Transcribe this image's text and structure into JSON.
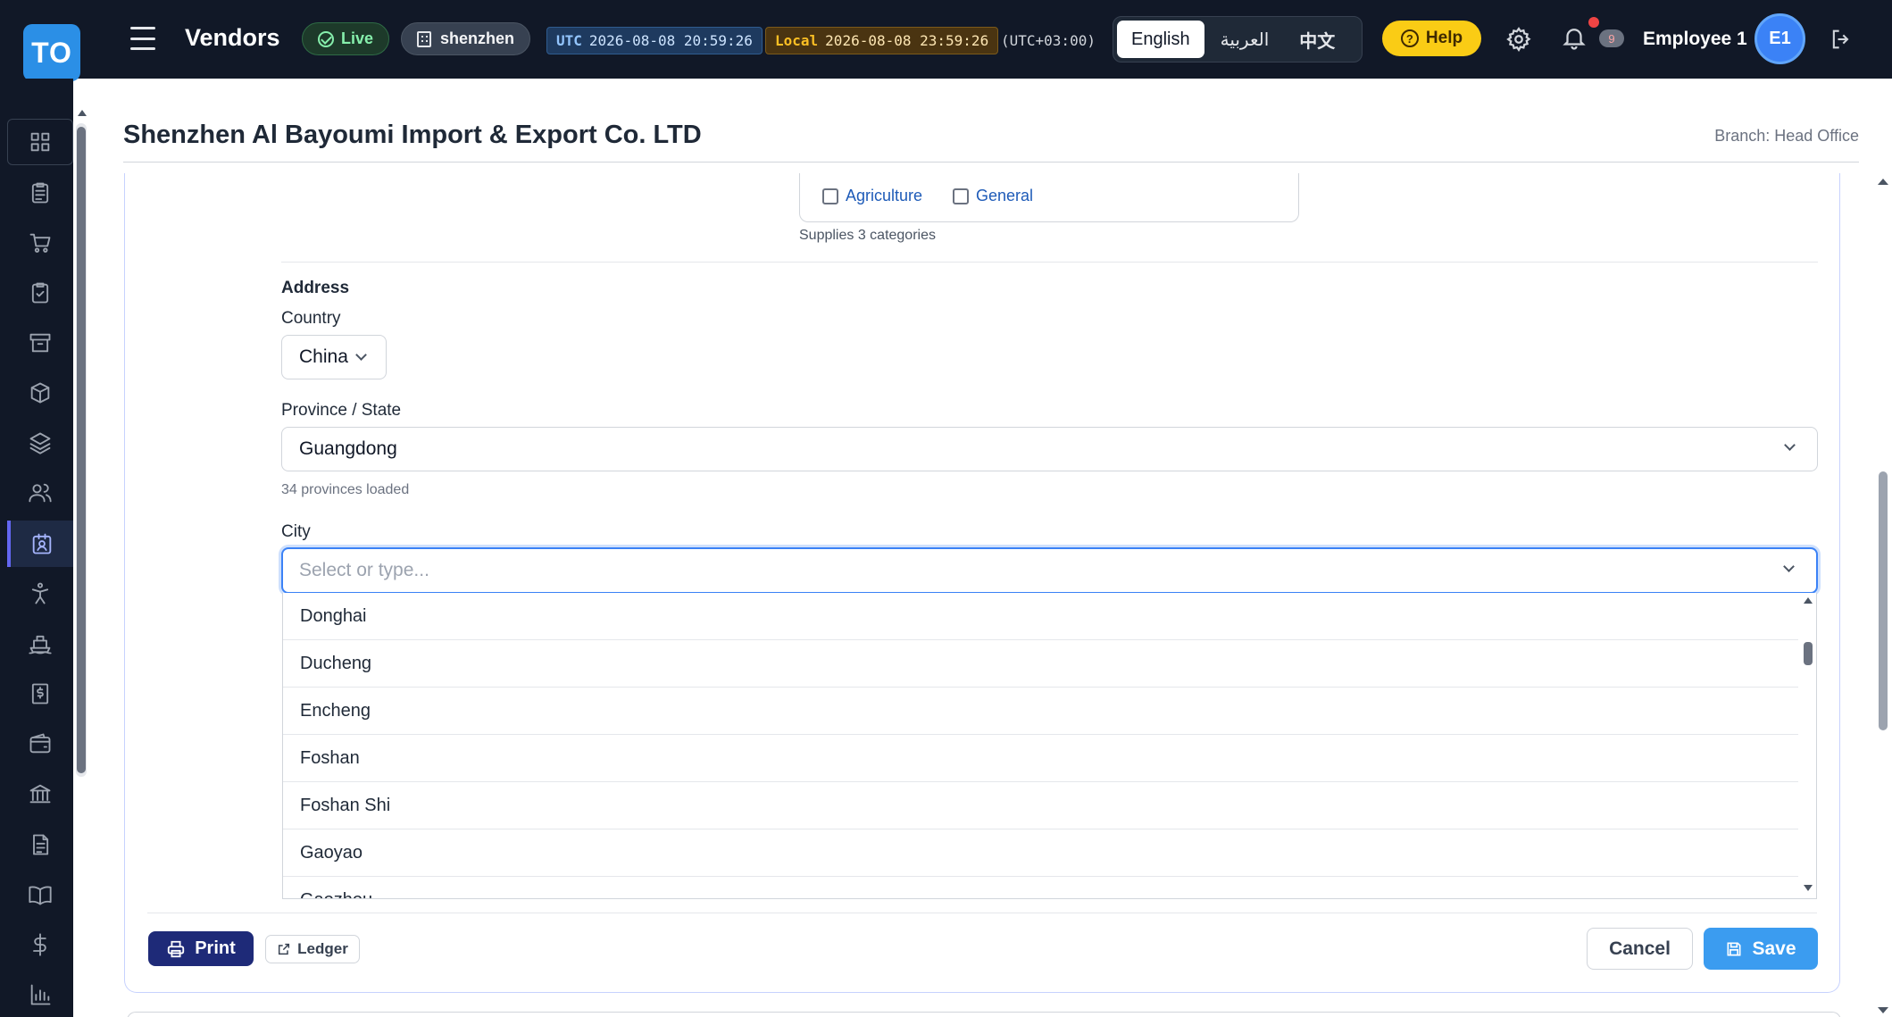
{
  "header": {
    "logo_text": "TO",
    "app_title": "Vendors",
    "live_label": "Live",
    "branch_code": "shenzhen",
    "utc_label": "UTC",
    "utc_time": "2026-08-08 20:59:26",
    "local_label": "Local",
    "local_time": "2026-08-08 23:59:26",
    "timezone": "(UTC+03:00)",
    "languages": [
      "English",
      "العربية",
      "中文"
    ],
    "active_language": "English",
    "help_label": "Help",
    "notification_count": "9",
    "user_name": "Employee 1",
    "user_initials": "E1"
  },
  "sidebar": {
    "items": [
      {
        "icon": "dashboard-grid-icon"
      },
      {
        "icon": "clipboard-list-icon"
      },
      {
        "icon": "shopping-cart-icon"
      },
      {
        "icon": "clipboard-check-icon"
      },
      {
        "icon": "archive-box-icon"
      },
      {
        "icon": "package-cube-icon"
      },
      {
        "icon": "layers-icon"
      },
      {
        "icon": "users-icon"
      },
      {
        "icon": "vendor-badge-icon",
        "active": true
      },
      {
        "icon": "accessibility-person-icon"
      },
      {
        "icon": "ship-icon"
      },
      {
        "icon": "dollar-receipt-icon"
      },
      {
        "icon": "wallet-icon"
      },
      {
        "icon": "bank-icon"
      },
      {
        "icon": "document-icon"
      },
      {
        "icon": "book-open-icon"
      },
      {
        "icon": "dollar-sign-icon"
      },
      {
        "icon": "bar-chart-icon"
      }
    ]
  },
  "page": {
    "title": "Shenzhen Al Bayoumi Import & Export Co. LTD",
    "branch": "Branch: Head Office"
  },
  "categories": {
    "items": [
      {
        "label": "Agriculture",
        "checked": false
      },
      {
        "label": "General",
        "checked": false
      }
    ],
    "summary": "Supplies 3 categories"
  },
  "address": {
    "section_label": "Address",
    "country_label": "Country",
    "country_value": "China",
    "province_label": "Province / State",
    "province_value": "Guangdong",
    "province_hint": "34 provinces loaded",
    "city_label": "City",
    "city_placeholder": "Select or type...",
    "city_options": [
      "Donghai",
      "Ducheng",
      "Encheng",
      "Foshan",
      "Foshan Shi",
      "Gaoyao",
      "Gaozhou"
    ]
  },
  "footer": {
    "print_label": "Print",
    "ledger_label": "Ledger",
    "cancel_label": "Cancel",
    "save_label": "Save"
  },
  "colors": {
    "topbar_bg": "#111827",
    "accent_blue": "#3b82f6",
    "print_btn": "#1e2a78",
    "save_btn": "#3b9cf0",
    "help_yellow": "#facc15"
  }
}
